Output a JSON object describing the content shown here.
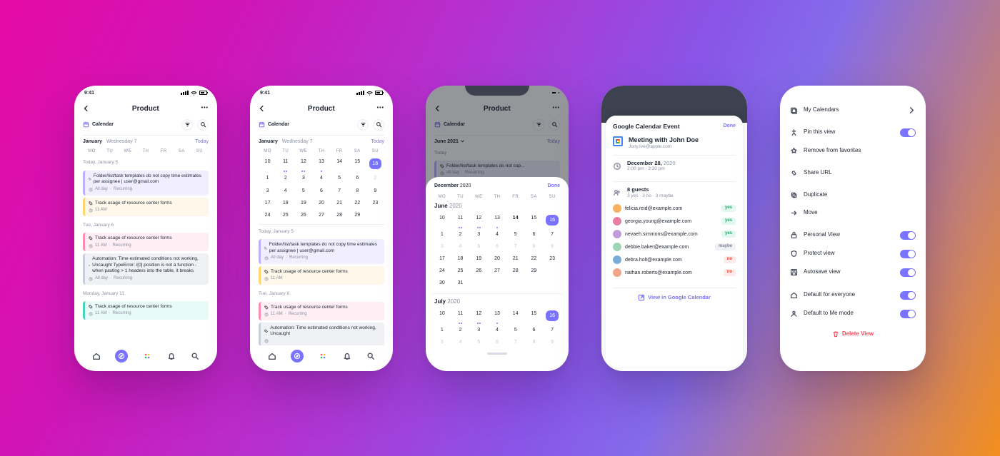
{
  "status_time": "9:41",
  "dow_labels": [
    "MO",
    "TU",
    "WE",
    "TH",
    "FR",
    "SA",
    "SU"
  ],
  "p1": {
    "title": "Product",
    "view_label": "Calendar",
    "month": "January",
    "weekday": "Wednesday 7",
    "today_label": "Today",
    "days": [
      {
        "label": "Today, January 5",
        "events": [
          {
            "color": "purple",
            "title": "Folder/list/task templates do not copy time estimates per assignee | user@gmail.com",
            "meta_time": "All day",
            "meta_extra": "Recurring"
          },
          {
            "color": "yellow",
            "title": "Track usage of resource center forms",
            "meta_time": "11 AM",
            "meta_extra": ""
          }
        ]
      },
      {
        "label": "Tue, January 6",
        "events": [
          {
            "color": "pink",
            "title": "Track usage of resource center forms",
            "meta_time": "11 AM",
            "meta_extra": "Recurring"
          },
          {
            "color": "gray",
            "title": "Automation: Time estimated conditions not working, Uncaught TypeError: i[0].position is not a function - when pasting > 1 headers into the table, it breaks",
            "meta_time": "All day",
            "meta_extra": "Recurring"
          }
        ]
      },
      {
        "label": "Monday, January 11",
        "events": [
          {
            "color": "teal",
            "title": "Track usage of resource center forms",
            "meta_time": "11 AM",
            "meta_extra": "Recurring"
          }
        ]
      }
    ]
  },
  "p2": {
    "title": "Product",
    "view_label": "Calendar",
    "month": "January",
    "weekday": "Wednesday 7",
    "today_label": "Today",
    "grid": [
      {
        "n": 10,
        "dots": 0
      },
      {
        "n": 11,
        "dots": 2
      },
      {
        "n": 12,
        "dots": 2
      },
      {
        "n": 13,
        "dots": 1
      },
      {
        "n": 14,
        "dots": 0
      },
      {
        "n": 15,
        "dots": 0
      },
      {
        "n": 16,
        "dots": 0,
        "sel": true
      },
      {
        "n": 1,
        "dots": 0
      },
      {
        "n": 2,
        "dots": 0
      },
      {
        "n": 3,
        "dots": 0
      },
      {
        "n": 4,
        "dots": 0
      },
      {
        "n": 5,
        "dots": 0
      },
      {
        "n": 6,
        "dots": 0
      },
      {
        "n": 2,
        "dots": 0,
        "dim": true
      },
      {
        "n": 3,
        "dots": 0
      },
      {
        "n": 4,
        "dots": 0
      },
      {
        "n": 5,
        "dots": 0
      },
      {
        "n": 6,
        "dots": 0
      },
      {
        "n": 7,
        "dots": 0
      },
      {
        "n": 8,
        "dots": 0
      },
      {
        "n": 9,
        "dots": 0
      },
      {
        "n": 17,
        "dots": 0
      },
      {
        "n": 18,
        "dots": 0
      },
      {
        "n": 19,
        "dots": 0
      },
      {
        "n": 20,
        "dots": 0
      },
      {
        "n": 21,
        "dots": 0
      },
      {
        "n": 22,
        "dots": 0
      },
      {
        "n": 23,
        "dots": 0
      },
      {
        "n": 24,
        "dots": 0
      },
      {
        "n": 25,
        "dots": 0
      },
      {
        "n": 26,
        "dots": 0
      },
      {
        "n": 27,
        "dots": 0
      },
      {
        "n": 28,
        "dots": 0
      },
      {
        "n": 29,
        "dots": 0
      },
      {
        "n": "",
        "dots": 0
      }
    ],
    "days": [
      {
        "label": "Today, January 5",
        "events": [
          {
            "color": "purple",
            "title": "Folder/list/task templates do not copy time estimates per assignee | user@gmail.com",
            "meta_time": "All day",
            "meta_extra": "Recurring"
          },
          {
            "color": "yellow",
            "title": "Track usage of resource center forms",
            "meta_time": "11 AM",
            "meta_extra": ""
          }
        ]
      },
      {
        "label": "Tue, January 6",
        "events": [
          {
            "color": "pink",
            "title": "Track usage of resource center forms",
            "meta_time": "11 AM",
            "meta_extra": "Recurring"
          },
          {
            "color": "gray",
            "title": "Automation: Time estimated conditions not working, Uncaught",
            "meta_time": "",
            "meta_extra": ""
          }
        ]
      }
    ]
  },
  "p3": {
    "title": "Product",
    "view_label": "Calendar",
    "month_under": "June 2021",
    "today_label": "Today",
    "day_under_label": "Today",
    "ev_under": {
      "title": "Folder/list/task templates do not cop...",
      "meta_time": "All day",
      "meta_extra": "Recurring"
    },
    "sheet_top": {
      "month": "December",
      "year": "2020",
      "done": "Done"
    },
    "months": [
      {
        "label": "June",
        "year": "2020",
        "grid": [
          {
            "n": 10
          },
          {
            "n": 11,
            "dots": 2
          },
          {
            "n": 12,
            "dots": 2
          },
          {
            "n": 13,
            "dots": 1
          },
          {
            "n": 14,
            "today": true
          },
          {
            "n": 15
          },
          {
            "n": 16,
            "sel": true
          },
          {
            "n": 1
          },
          {
            "n": 2
          },
          {
            "n": 3
          },
          {
            "n": 4
          },
          {
            "n": 5
          },
          {
            "n": 6
          },
          {
            "n": 7
          },
          {
            "n": 3,
            "dim": true
          },
          {
            "n": 4,
            "dim": true
          },
          {
            "n": 5,
            "dim": true
          },
          {
            "n": 6,
            "dim": true
          },
          {
            "n": 7,
            "dim": true
          },
          {
            "n": 8,
            "dim": true
          },
          {
            "n": 9,
            "dim": true
          },
          {
            "n": 17
          },
          {
            "n": 18
          },
          {
            "n": 19
          },
          {
            "n": 20
          },
          {
            "n": 21
          },
          {
            "n": 22
          },
          {
            "n": 23
          },
          {
            "n": 24
          },
          {
            "n": 25
          },
          {
            "n": 26
          },
          {
            "n": 27
          },
          {
            "n": 28
          },
          {
            "n": 29
          },
          {
            "n": ""
          },
          {
            "n": 30
          },
          {
            "n": 31
          },
          {
            "n": ""
          },
          {
            "n": ""
          },
          {
            "n": ""
          },
          {
            "n": ""
          },
          {
            "n": ""
          }
        ]
      },
      {
        "label": "July",
        "year": "2020",
        "grid": [
          {
            "n": 10
          },
          {
            "n": 11,
            "dots": 2
          },
          {
            "n": 12,
            "dots": 2
          },
          {
            "n": 13,
            "dots": 1
          },
          {
            "n": 14
          },
          {
            "n": 15
          },
          {
            "n": 16,
            "sel": true
          },
          {
            "n": 1
          },
          {
            "n": 2
          },
          {
            "n": 3
          },
          {
            "n": 4
          },
          {
            "n": 5
          },
          {
            "n": 6
          },
          {
            "n": 7
          },
          {
            "n": 3,
            "dim": true
          },
          {
            "n": 4,
            "dim": true
          },
          {
            "n": 5,
            "dim": true
          },
          {
            "n": 6,
            "dim": true
          },
          {
            "n": 7,
            "dim": true
          },
          {
            "n": 8,
            "dim": true
          },
          {
            "n": 9,
            "dim": true
          }
        ]
      }
    ]
  },
  "p4": {
    "modal_title": "Google Calendar Event",
    "done_label": "Done",
    "event_title": "Meeting with John Doe",
    "event_sub": "Jony.Ive@apple.com",
    "date_bold": "December 28,",
    "date_year": "2020",
    "time_range": "2:00 pm - 3:30 pm",
    "guest_count": "8 guests",
    "guest_summary": "3 yes  ·  3 no  ·  3 maybe",
    "guests": [
      {
        "email": "felicia.reid@example.com",
        "rsvp": "yes",
        "av": "#f5b15e"
      },
      {
        "email": "georgia.young@example.com",
        "rsvp": "yes",
        "av": "#e77fa3"
      },
      {
        "email": "nevaeh.simmons@example.com",
        "rsvp": "yes",
        "av": "#c49bd9"
      },
      {
        "email": "debbie.baker@example.com",
        "rsvp": "maybe",
        "av": "#9ed6b5"
      },
      {
        "email": "debra.holt@example.com",
        "rsvp": "no",
        "av": "#7aaed8"
      },
      {
        "email": "nathan.roberts@example.com",
        "rsvp": "no",
        "av": "#f0a48a"
      }
    ],
    "view_link": "View in Google Calendar"
  },
  "p5": {
    "rows": [
      {
        "icon": "calendars",
        "label": "My Calendars",
        "right": "chev"
      },
      {
        "gap": true
      },
      {
        "icon": "pin",
        "label": "Pin this view",
        "right": "toggle"
      },
      {
        "icon": "star",
        "label": "Remove from favorites"
      },
      {
        "gap": true
      },
      {
        "icon": "link",
        "label": "Share URL"
      },
      {
        "gap": true
      },
      {
        "icon": "copy",
        "label": "Duplicate"
      },
      {
        "icon": "move",
        "label": "Move"
      },
      {
        "gap": true
      },
      {
        "icon": "lock",
        "label": "Personal View",
        "right": "toggle"
      },
      {
        "icon": "shield",
        "label": "Protect view",
        "right": "toggle"
      },
      {
        "icon": "save",
        "label": "Autosave view",
        "right": "toggle"
      },
      {
        "gap": true
      },
      {
        "icon": "home",
        "label": "Default for everyone",
        "right": "toggle"
      },
      {
        "icon": "person",
        "label": "Default to Me mode",
        "right": "toggle"
      }
    ],
    "delete_label": "Delete View"
  }
}
